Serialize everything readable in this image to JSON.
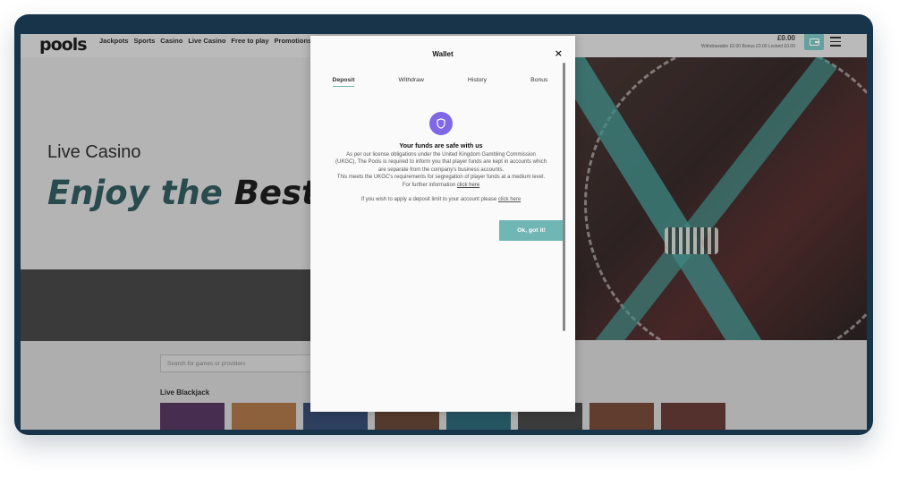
{
  "header": {
    "logo": "pools",
    "nav": [
      "Jackpots",
      "Sports",
      "Casino",
      "Live Casino",
      "Free to play",
      "Promotions"
    ],
    "balance": {
      "amount": "£0.00",
      "withdrawable": "Withdrawable £0.00",
      "bonus": "Bonus £0.00",
      "locked": "Locked £0.00"
    },
    "icons": [
      "cashier-icon",
      "hamburger-menu-icon"
    ]
  },
  "hero": {
    "subtitle": "Live Casino",
    "title_part1": "Enjoy the",
    "title_part2": "Best Li"
  },
  "search": {
    "placeholder": "Search for games or providers"
  },
  "section": {
    "title": "Live Blackjack"
  },
  "thumbs": [
    {
      "color": "#4a2a55"
    },
    {
      "color": "#a06a3e"
    },
    {
      "color": "#2b3f66"
    },
    {
      "color": "#5a3a2a"
    },
    {
      "color": "#1f5b6a"
    },
    {
      "color": "#3b3b3b"
    },
    {
      "color": "#6a3d2c"
    },
    {
      "color": "#5a2f2a"
    }
  ],
  "modal": {
    "title": "Wallet",
    "close": "×",
    "tabs": [
      "Deposit",
      "Withdraw",
      "History",
      "Bonus"
    ],
    "active_tab": "Deposit",
    "safe_title": "Your funds are safe with us",
    "text_line1": "As per our license obligations under the United Kingdom Gambling Commission",
    "text_line2": "(UKGC), The Pools is required to inform you that player funds are kept in accounts which",
    "text_line3": "are separate from the company's business accounts.",
    "text_line4": "This meets the UKGC's requirements for segregation of player funds at a medium level.",
    "text_line5": "For further information",
    "link1": "click here",
    "limit_text": "If you wish to apply a deposit limit to your account please",
    "link2": "click here",
    "ok_button": "Ok, got it!"
  },
  "colors": {
    "accent": "#6fb6b4",
    "shield": "#7f67e8",
    "frame": "#17344a"
  }
}
